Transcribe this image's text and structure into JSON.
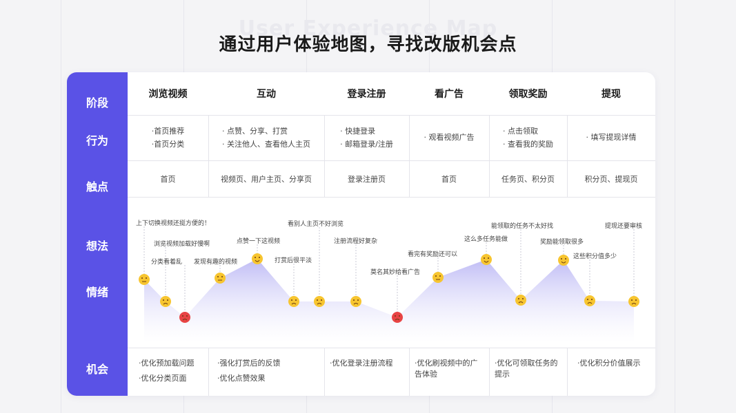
{
  "watermark": "User Experience Map",
  "title": "通过用户体验地图，寻找改版机会点",
  "rows": {
    "stage": "阶段",
    "behavior": "行为",
    "touchpoint": "触点",
    "thoughts": "想法",
    "emotion": "情绪",
    "opportunity": "机会"
  },
  "stages": [
    {
      "name": "浏览视频",
      "behaviors": [
        "·首页推荐",
        "·首页分类"
      ],
      "touchpoint": "首页",
      "opportunities": [
        "·优化预加载问题",
        "·优化分类页面"
      ]
    },
    {
      "name": "互动",
      "behaviors": [
        "· 点赞、分享、打赏",
        "· 关注他人、查看他人主页"
      ],
      "touchpoint": "视频页、用户主页、分享页",
      "opportunities": [
        "·强化打赏后的反馈",
        "·优化点赞效果"
      ]
    },
    {
      "name": "登录注册",
      "behaviors": [
        "· 快捷登录",
        "· 邮箱登录/注册"
      ],
      "touchpoint": "登录注册页",
      "opportunities": [
        "·优化登录注册流程"
      ]
    },
    {
      "name": "看广告",
      "behaviors": [
        "· 观看视频广告"
      ],
      "touchpoint": "首页",
      "opportunities": [
        "·优化刷视频中的广",
        "告体验"
      ]
    },
    {
      "name": "领取奖励",
      "behaviors": [
        "· 点击领取",
        "· 查看我的奖励"
      ],
      "touchpoint": "任务页、积分页",
      "opportunities": [
        "·优化可领取任务的",
        "提示"
      ]
    },
    {
      "name": "提现",
      "behaviors": [
        "· 填写提现详情"
      ],
      "touchpoint": "积分页、提现页",
      "opportunities": [
        "·优化积分价值展示"
      ]
    }
  ],
  "emotion_points": [
    {
      "label": "上下切换视频还挺方便的！",
      "mood": "neutral"
    },
    {
      "label": "浏览视频加载好慢啊",
      "mood": "unhappy"
    },
    {
      "label": "分类看着乱",
      "mood": "angry"
    },
    {
      "label": "发现有趣的视频",
      "mood": "neutral"
    },
    {
      "label": "点赞一下这视频",
      "mood": "happy"
    },
    {
      "label": "打赏后很平淡",
      "mood": "unhappy"
    },
    {
      "label": "看别人主页不好浏览",
      "mood": "unhappy"
    },
    {
      "label": "注册流程好复杂",
      "mood": "unhappy"
    },
    {
      "label": "莫名其妙给看广告",
      "mood": "angry"
    },
    {
      "label": "看完有奖励还可以",
      "mood": "neutral"
    },
    {
      "label": "这么多任务能做",
      "mood": "happy"
    },
    {
      "label": "能领取的任务不太好找",
      "mood": "unhappy"
    },
    {
      "label": "奖励能领取很多",
      "mood": "happy"
    },
    {
      "label": "这些积分值多少",
      "mood": "unhappy"
    },
    {
      "label": "提现还要审核",
      "mood": "unhappy"
    }
  ],
  "colors": {
    "sidebar": "#5a52e6",
    "area_top": "#b8b4f4",
    "emoji_yellow": "#f7c530",
    "emoji_red": "#e84444"
  }
}
